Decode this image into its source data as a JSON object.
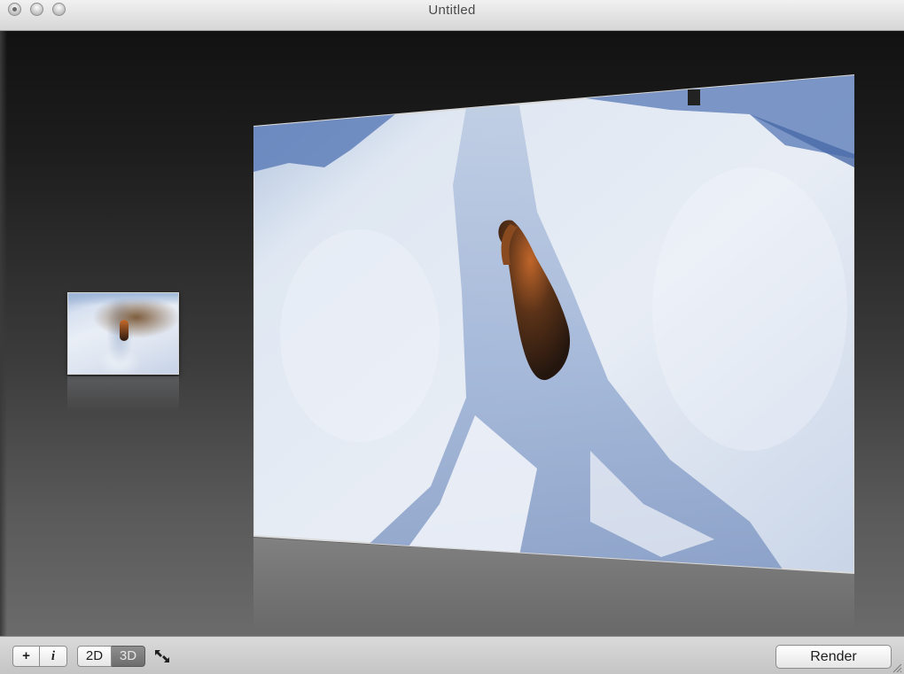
{
  "window": {
    "title": "Untitled"
  },
  "toolbar": {
    "add_label": "+",
    "info_label": "i",
    "mode_2d_label": "2D",
    "mode_3d_label": "3D",
    "selected_mode": "3D",
    "render_label": "Render"
  },
  "icons": {
    "close": "close-icon",
    "minimize": "minimize-icon",
    "zoom": "zoom-icon",
    "fullscreen": "expand-arrows-icon",
    "resize": "resize-grip-icon"
  },
  "colors": {
    "selected_segment": "#7a7a7a",
    "stage_dark": "#121212",
    "stage_light": "#6b6b6b"
  }
}
